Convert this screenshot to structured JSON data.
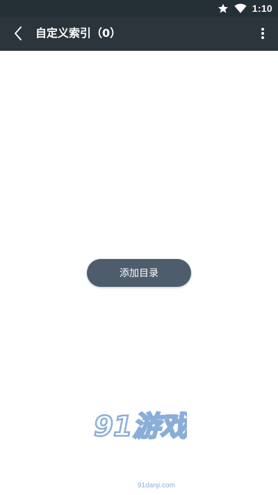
{
  "status_bar": {
    "time": "1:10",
    "icons": [
      "star-icon",
      "wifi-icon"
    ]
  },
  "toolbar": {
    "title": "自定义索引（0）",
    "back_icon": "chevron-left-icon",
    "menu_icon": "more-vert-icon"
  },
  "main": {
    "add_button_label": "添加目录"
  },
  "watermark": {
    "logo_text": "91游戏",
    "site": "91danji.com"
  },
  "colors": {
    "status_bar_bg": "#252f36",
    "toolbar_bg": "#2c353c",
    "button_bg": "#4e5d6b",
    "watermark": "#8aaed8"
  }
}
